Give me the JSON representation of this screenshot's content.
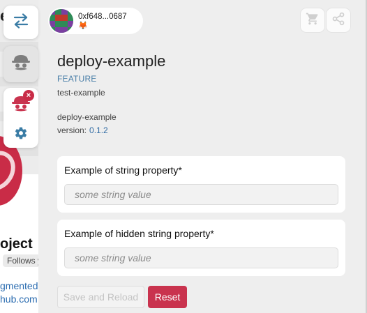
{
  "background_page": {
    "fragment_top": "e’",
    "project_title_fragment": "oject",
    "follows_fragment": "Follows yo",
    "link_fragment_1": "gmented",
    "link_fragment_2": "hub.com"
  },
  "sidebar": {
    "swap_icon": "swap-arrows-icon",
    "app_icon": "app-mascot-icon",
    "active_app_icon": "active-app-mascot-icon",
    "close_badge": "×",
    "settings_icon": "gear-icon"
  },
  "header": {
    "wallet_address": "0xf648...0687",
    "wallet_icon": "🦊",
    "cart_icon": "cart-icon",
    "share_icon": "share-icon"
  },
  "app": {
    "title": "deploy-example",
    "tag": "FEATURE",
    "subtitle": "test-example",
    "package_name": "deploy-example",
    "version_label": "version:",
    "version_value": "0.1.2"
  },
  "form": {
    "fields": [
      {
        "label": "Example of string property*",
        "value": "",
        "placeholder": "some string value"
      },
      {
        "label": "Example of hidden string property*",
        "value": "",
        "placeholder": "some string value"
      }
    ],
    "save_label": "Save and Reload",
    "reset_label": "Reset"
  },
  "colors": {
    "accent": "#c9334e",
    "tag": "#4a7fa8",
    "version": "#2f6aa3",
    "panel_bg": "#eeeeee"
  }
}
